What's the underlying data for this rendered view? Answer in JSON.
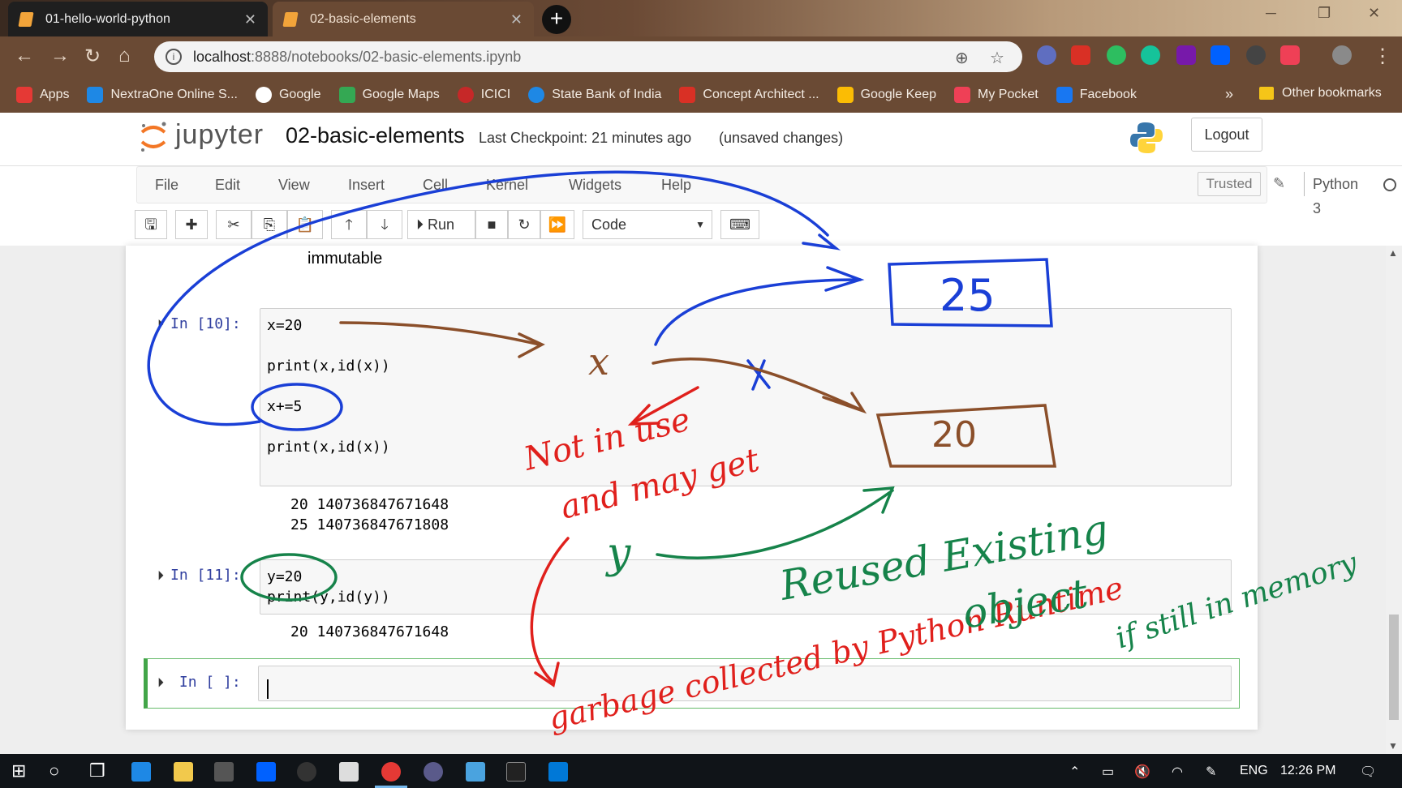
{
  "browser": {
    "tabs": [
      {
        "label": "01-hello-world-python",
        "close": "✕"
      },
      {
        "label": "02-basic-elements",
        "close": "✕"
      }
    ],
    "new_tab": "+",
    "url_host": "localhost",
    "url_path": ":8888/notebooks/02-basic-elements.ipynb",
    "bookmarks": [
      {
        "label": "Apps",
        "color": "#e53935"
      },
      {
        "label": "NextraOne Online S...",
        "color": "#1e88e5"
      },
      {
        "label": "Google",
        "color": "#ffffff"
      },
      {
        "label": "Google Maps",
        "color": "#34a853"
      },
      {
        "label": "ICICI",
        "color": "#c62828"
      },
      {
        "label": "State Bank of India",
        "color": "#1e88e5"
      },
      {
        "label": "Concept Architect ...",
        "color": "#d93025"
      },
      {
        "label": "Google Keep",
        "color": "#fbbc04"
      },
      {
        "label": "My Pocket",
        "color": "#ef4056"
      },
      {
        "label": "Facebook",
        "color": "#1877f2"
      }
    ],
    "bookmarks_more": "»",
    "other_bookmarks": "Other bookmarks"
  },
  "jupyter": {
    "logo_text": "jupyter",
    "notebook_title": "02-basic-elements",
    "checkpoint": "Last Checkpoint: 21 minutes ago",
    "unsaved": "(unsaved changes)",
    "logout": "Logout",
    "menu": [
      "File",
      "Edit",
      "View",
      "Insert",
      "Cell",
      "Kernel",
      "Widgets",
      "Help"
    ],
    "trusted": "Trusted",
    "kernel": "Python 3",
    "run_label": "Run",
    "cell_type": "Code"
  },
  "notebook": {
    "markdown_fragment": "immutable",
    "cell1": {
      "prompt": "In [10]:",
      "lines": [
        "x=20",
        "print(x,id(x))",
        "x+=5",
        "print(x,id(x))"
      ],
      "output": [
        "20 140736847671648",
        "25 140736847671808"
      ]
    },
    "cell2": {
      "prompt": "In [11]:",
      "lines": [
        "y=20",
        "print(y,id(y))"
      ],
      "output": [
        "20 140736847671648"
      ]
    },
    "cell3": {
      "prompt": "In [ ]:"
    }
  },
  "annotations": {
    "box_top": "25",
    "box_bottom": "20",
    "var_x": "x",
    "var_y": "y",
    "cross": "X",
    "red_note_1": "Not in use",
    "red_note_2": "and may get",
    "red_note_3": "garbage collected by Python Runtime",
    "green_note_1": "Reused Existing",
    "green_note_2": "object",
    "green_note_3": "if still in memory",
    "colors": {
      "blue": "#1a3fd6",
      "brown": "#8b4f2a",
      "red": "#e0201c",
      "green": "#16834a"
    }
  },
  "taskbar": {
    "lang": "ENG",
    "time": "12:26 PM"
  }
}
